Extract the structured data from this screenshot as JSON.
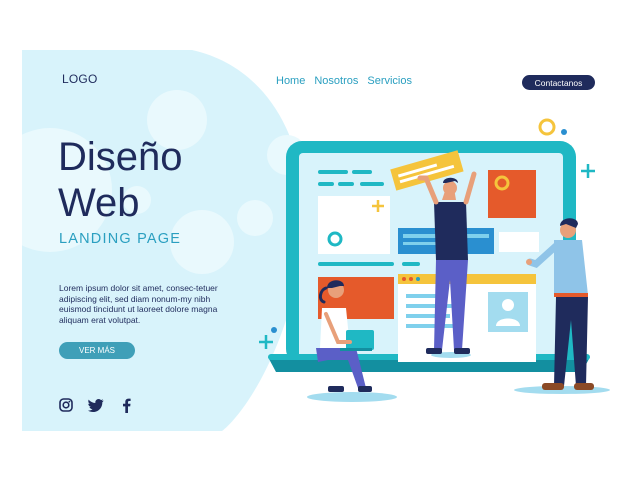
{
  "header": {
    "logo": "LOGO",
    "nav": [
      "Home",
      "Nosotros",
      "Servicios"
    ],
    "contact_label": "Contactanos"
  },
  "hero": {
    "title_line1": "Diseño",
    "title_line2": "Web",
    "subtitle": "LANDING PAGE",
    "description": "Lorem ipsum dolor sit amet, consec-tetuer adipiscing elit, sed diam nonum-my nibh euismod tincidunt ut laoreet dolore magna aliquam erat volutpat.",
    "cta_label": "VER MÁS"
  },
  "social": [
    "instagram-icon",
    "twitter-icon",
    "facebook-icon"
  ],
  "colors": {
    "navy": "#1f2b5c",
    "accent": "#2a9fc0",
    "light_bg": "#d8f3fb",
    "orange": "#e55a2b",
    "yellow": "#f5c43c",
    "teal": "#1fb8c4"
  }
}
